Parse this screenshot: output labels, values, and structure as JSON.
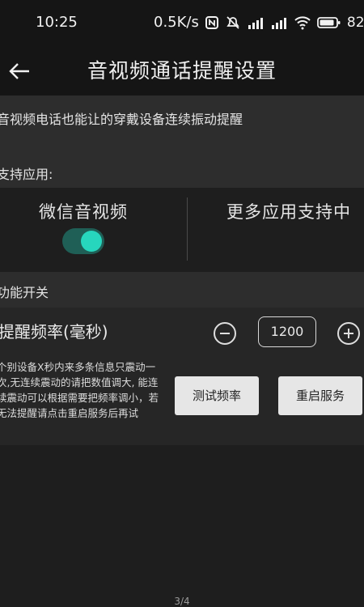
{
  "status_bar": {
    "time": "10:25",
    "speed": "0.5K/s",
    "battery": "82"
  },
  "header": {
    "title": "音视频通话提醒设置"
  },
  "description": {
    "text": "音视频电话也能让的穿戴设备连续振动提醒"
  },
  "support": {
    "label": "支持应用:",
    "apps": [
      {
        "name": "微信音视频",
        "enabled": true
      },
      {
        "name": "更多应用支持中"
      }
    ]
  },
  "function": {
    "label": "功能开关"
  },
  "frequency": {
    "label": "提醒频率(毫秒)",
    "value": "1200",
    "note": "个别设备X秒内来多条信息只震动一次,无连续震动的请把数值调大, 能连续震动可以根据需要把频率调小，若无法提醒请点击重启服务后再试",
    "test_button": "测试频率",
    "restart_button": "重启服务"
  },
  "pager": {
    "text": "3/4"
  },
  "colors": {
    "accent": "#27d6bd",
    "toggle_track": "#1f5f56"
  }
}
